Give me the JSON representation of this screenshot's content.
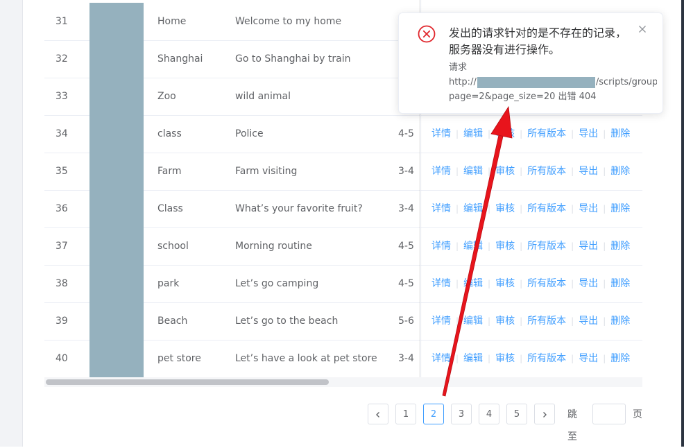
{
  "table": {
    "rows": [
      {
        "id": "31",
        "name": "Home",
        "title": "Welcome to my home",
        "level": ""
      },
      {
        "id": "32",
        "name": "Shanghai",
        "title": "Go to Shanghai by train",
        "level": ""
      },
      {
        "id": "33",
        "name": "Zoo",
        "title": "wild animal",
        "level": ""
      },
      {
        "id": "34",
        "name": "class",
        "title": "Police",
        "level": "4-5"
      },
      {
        "id": "35",
        "name": "Farm",
        "title": "Farm visiting",
        "level": "3-4"
      },
      {
        "id": "36",
        "name": "Class",
        "title": "What’s your favorite fruit?",
        "level": "3-4"
      },
      {
        "id": "37",
        "name": "school",
        "title": "Morning routine",
        "level": "4-5"
      },
      {
        "id": "38",
        "name": "park",
        "title": "Let’s go camping",
        "level": "4-5"
      },
      {
        "id": "39",
        "name": "Beach",
        "title": "Let’s go to the beach",
        "level": "5-6"
      },
      {
        "id": "40",
        "name": "pet store",
        "title": "Let’s have a look at pet store",
        "level": "3-4"
      }
    ],
    "actions": {
      "detail": "详情",
      "edit": "编辑",
      "review": "审核",
      "versions": "所有版本",
      "export": "导出",
      "delete": "删除"
    }
  },
  "pagination": {
    "prev_icon": "chevron-left-icon",
    "next_icon": "chevron-right-icon",
    "pages": [
      "1",
      "2",
      "3",
      "4",
      "5"
    ],
    "current_page": "2",
    "jump_label": "跳至",
    "jump_value": "",
    "page_suffix": "页"
  },
  "toast": {
    "icon": "error-circle-icon",
    "title": "发出的请求针对的是不存在的记录，服务器没有进行操作。",
    "request_label": "请求",
    "url_prefix": "http://",
    "url_suffix": "/scripts/group_c",
    "url_line2": "page=2&page_size=20 出错 404"
  },
  "colors": {
    "link": "#409eff",
    "error": "#e0262c",
    "arrow": "#e8141c",
    "redaction": "#95b1be"
  }
}
